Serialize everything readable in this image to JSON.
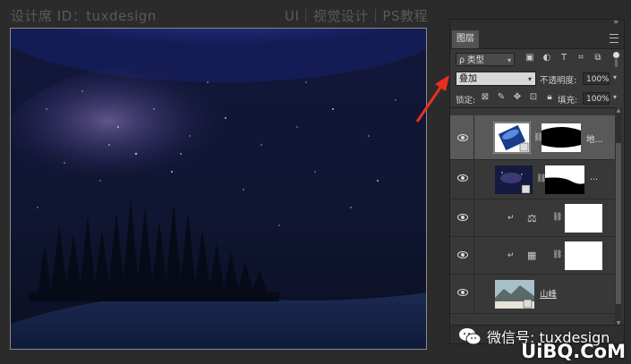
{
  "watermarks": {
    "top_left": "设计席 ID：tuxdesign",
    "top_right": "UI｜视觉设计｜PS教程",
    "wechat": "微信号: tuxdesign",
    "site": "UiBQ.CoM"
  },
  "panel": {
    "tab_label": "图层",
    "filter": {
      "label": "ρ 类型"
    },
    "blend_mode": "叠加",
    "opacity_label": "不透明度:",
    "opacity_value": "100%",
    "lock_label": "锁定:",
    "fill_label": "填充:",
    "fill_value": "100%",
    "layers": [
      {
        "name": "地...",
        "selected": true
      },
      {
        "name": "...",
        "selected": false
      },
      {
        "name": "",
        "selected": false
      },
      {
        "name": "",
        "selected": false
      },
      {
        "name": "山峰",
        "selected": false
      }
    ]
  },
  "icons": {
    "filter_icons": [
      "image-filter-icon",
      "adjustment-filter-icon",
      "type-filter-icon",
      "shape-filter-icon",
      "smart-object-filter-icon"
    ],
    "lock_icons": [
      "lock-transparent-icon",
      "lock-image-icon",
      "lock-position-icon",
      "lock-artboard-icon",
      "lock-all-icon"
    ]
  },
  "colors": {
    "panel_bg": "#383838",
    "selected_layer": "#595959",
    "arrow": "#e8301c"
  }
}
